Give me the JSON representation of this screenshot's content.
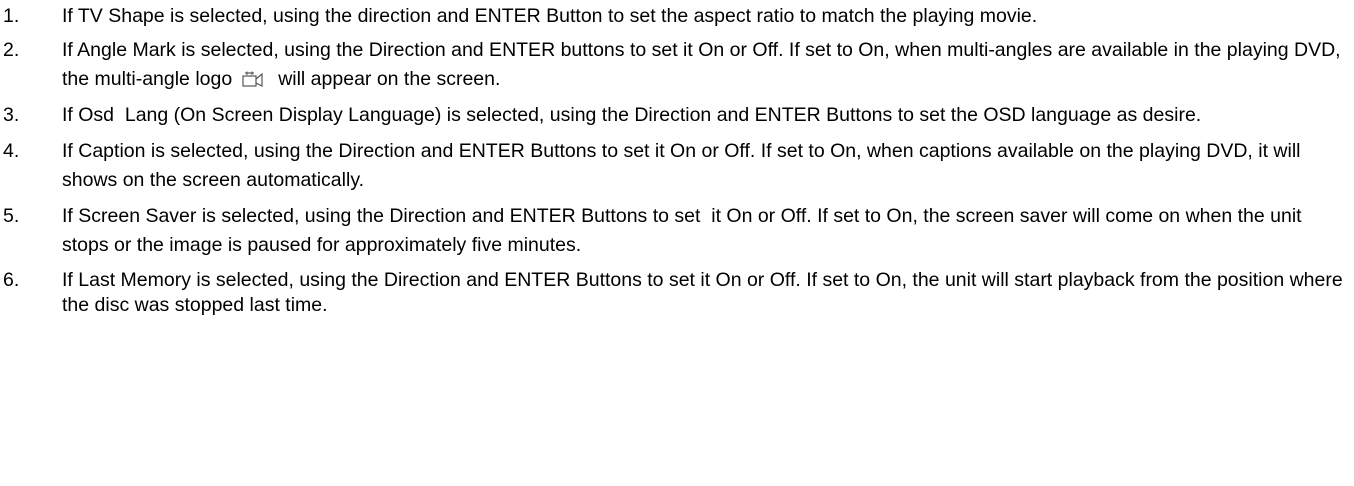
{
  "items": [
    {
      "number": "1.",
      "text": "If TV Shape is selected, using the direction and ENTER Button to set the aspect ratio to match the playing movie."
    },
    {
      "number": "2.",
      "text_before_icon": "If Angle Mark is selected, using the Direction and ENTER buttons to set it On or Off. If set to On, when multi-angles are available in the playing DVD, the multi-angle logo",
      "icon": "multi-angle-camera-icon",
      "text_after_icon": "will appear on the screen."
    },
    {
      "number": "3.",
      "text": "If Osd  Lang (On Screen Display Language) is selected, using the Direction and ENTER Buttons to set the OSD language as desire."
    },
    {
      "number": "4.",
      "text": "If Caption is selected, using the Direction and ENTER Buttons to set it On or Off. If set to On, when captions available on the playing DVD, it will shows on the screen automatically."
    },
    {
      "number": "5.",
      "text": "If Screen Saver is selected, using the Direction and ENTER Buttons to set  it On or Off. If set to On, the screen saver will come on when the unit stops or the image is paused for approximately five minutes."
    },
    {
      "number": "6.",
      "text": "If Last Memory is selected, using the Direction and ENTER Buttons to set it On or Off. If set to On, the unit will start playback from the position where the disc was stopped last time."
    }
  ]
}
